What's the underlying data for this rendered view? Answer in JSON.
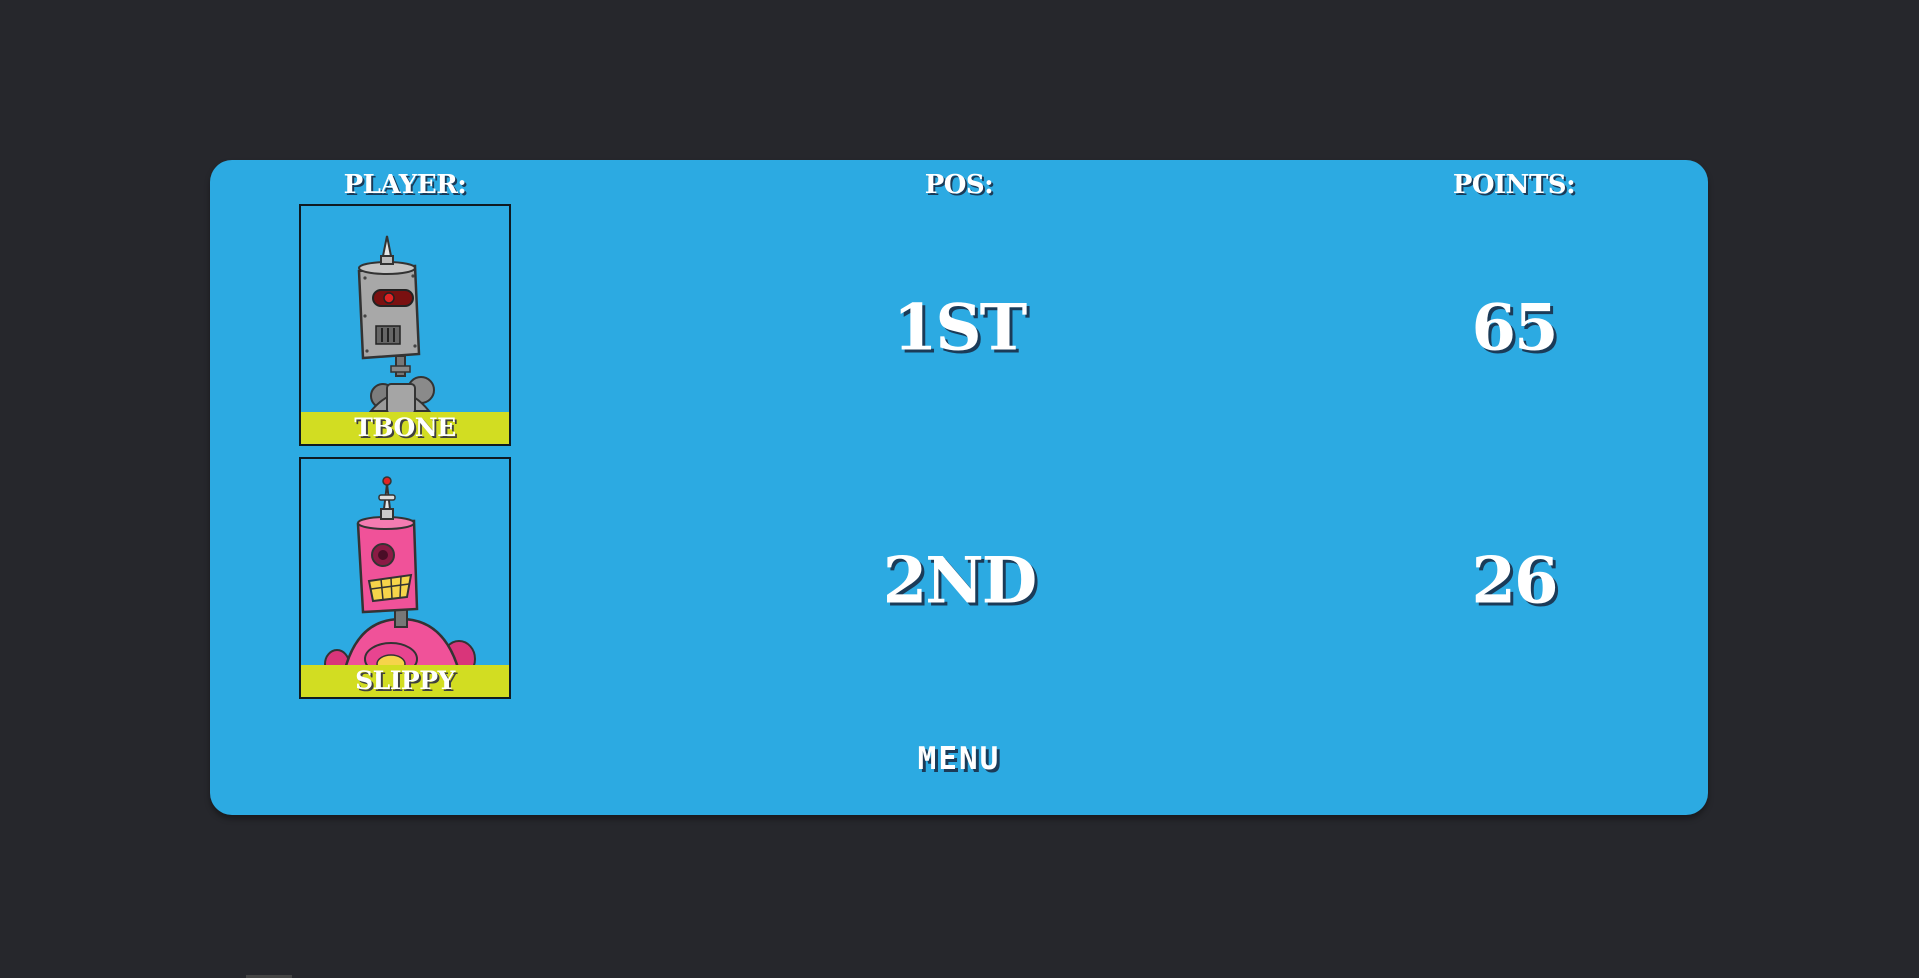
{
  "headers": {
    "player": "PLAYER:",
    "pos": "POS:",
    "points": "POINTS:"
  },
  "rows": [
    {
      "name": "TBONE",
      "position": "1ST",
      "points": "65",
      "avatar": "grey-robot-avatar"
    },
    {
      "name": "SLIPPY",
      "position": "2ND",
      "points": "26",
      "avatar": "pink-robot-avatar"
    }
  ],
  "menu": {
    "label": "MENU"
  },
  "colors": {
    "background": "#26272c",
    "panel": "#2caae2",
    "nameplate": "#d2dd22",
    "text": "#ffffff"
  }
}
